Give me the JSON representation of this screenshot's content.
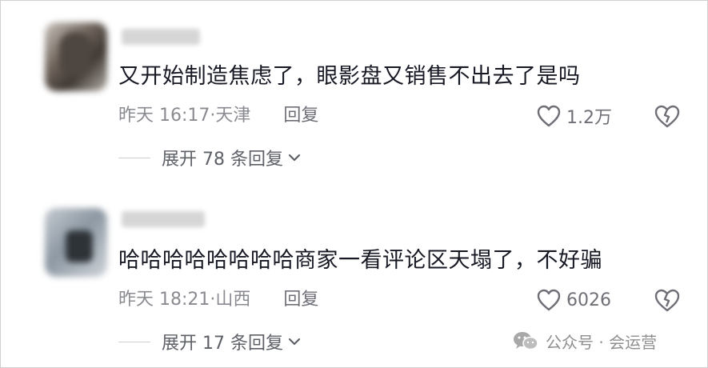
{
  "comments": [
    {
      "text": "又开始制造焦虑了，眼影盘又销售不出去了是吗",
      "time": "昨天 16:17",
      "sep": "·",
      "location": "天津",
      "reply_label": "回复",
      "likes": "1.2万",
      "expand_label": "展开 78 条回复"
    },
    {
      "text": "哈哈哈哈哈哈哈哈商家一看评论区天塌了，不好骗",
      "time": "昨天 18:21",
      "sep": "·",
      "location": "山西",
      "reply_label": "回复",
      "likes": "6026",
      "expand_label": "展开 17 条回复"
    }
  ],
  "watermark": {
    "text": "公众号 · 会运营"
  },
  "icons": {
    "like": "heart-outline-icon",
    "dislike": "broken-heart-icon",
    "expand": "chevron-down-icon",
    "watermark": "wechat-icon"
  }
}
